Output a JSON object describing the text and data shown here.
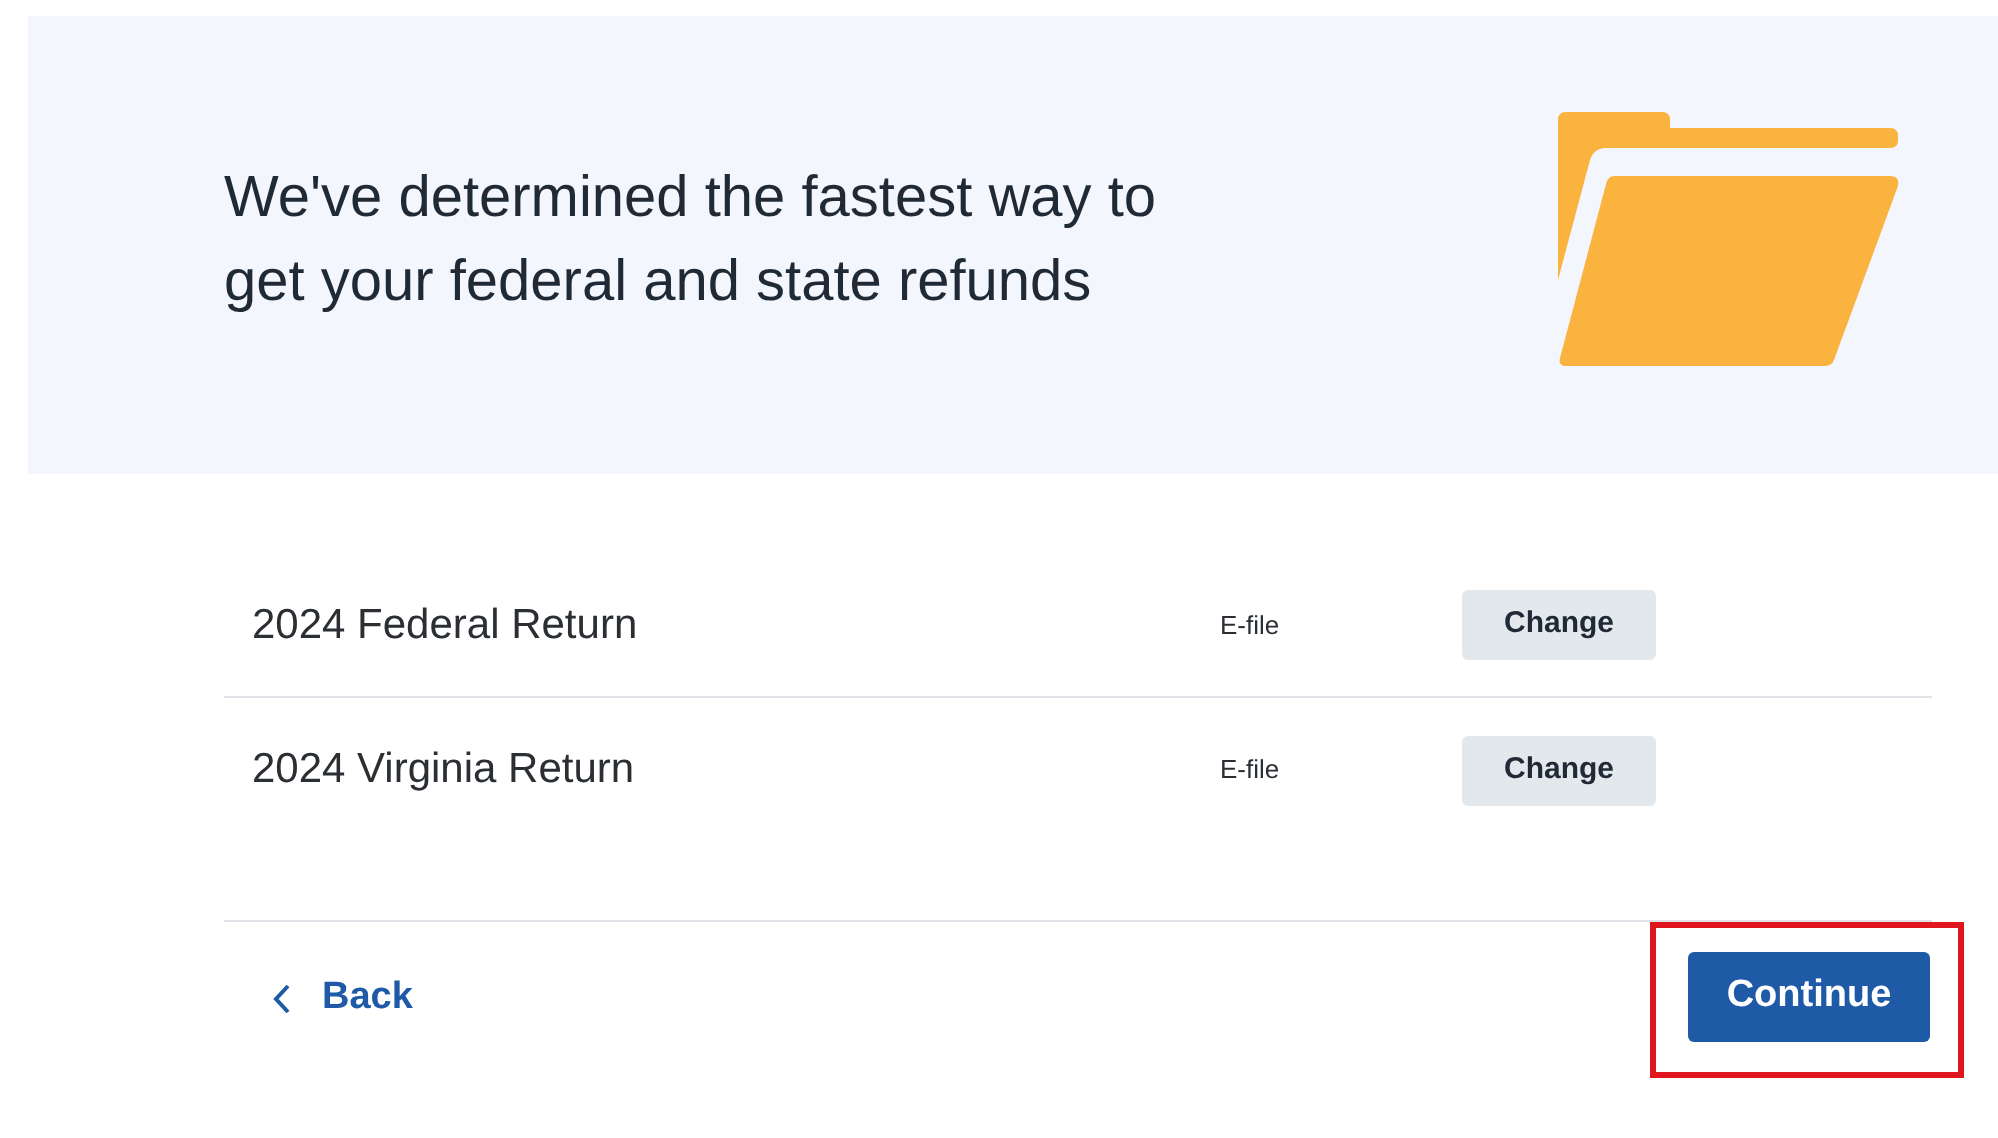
{
  "banner": {
    "heading_lines": [
      "We've determined the fastest way to",
      "get your federal and state refunds"
    ]
  },
  "returns": [
    {
      "name": "2024 Federal Return",
      "method": "E-file",
      "action": "Change"
    },
    {
      "name": "2024 Virginia Return",
      "method": "E-file",
      "action": "Change"
    }
  ],
  "footer": {
    "back": "Back",
    "continue": {
      "label": "Continue",
      "highlighted": true
    }
  }
}
